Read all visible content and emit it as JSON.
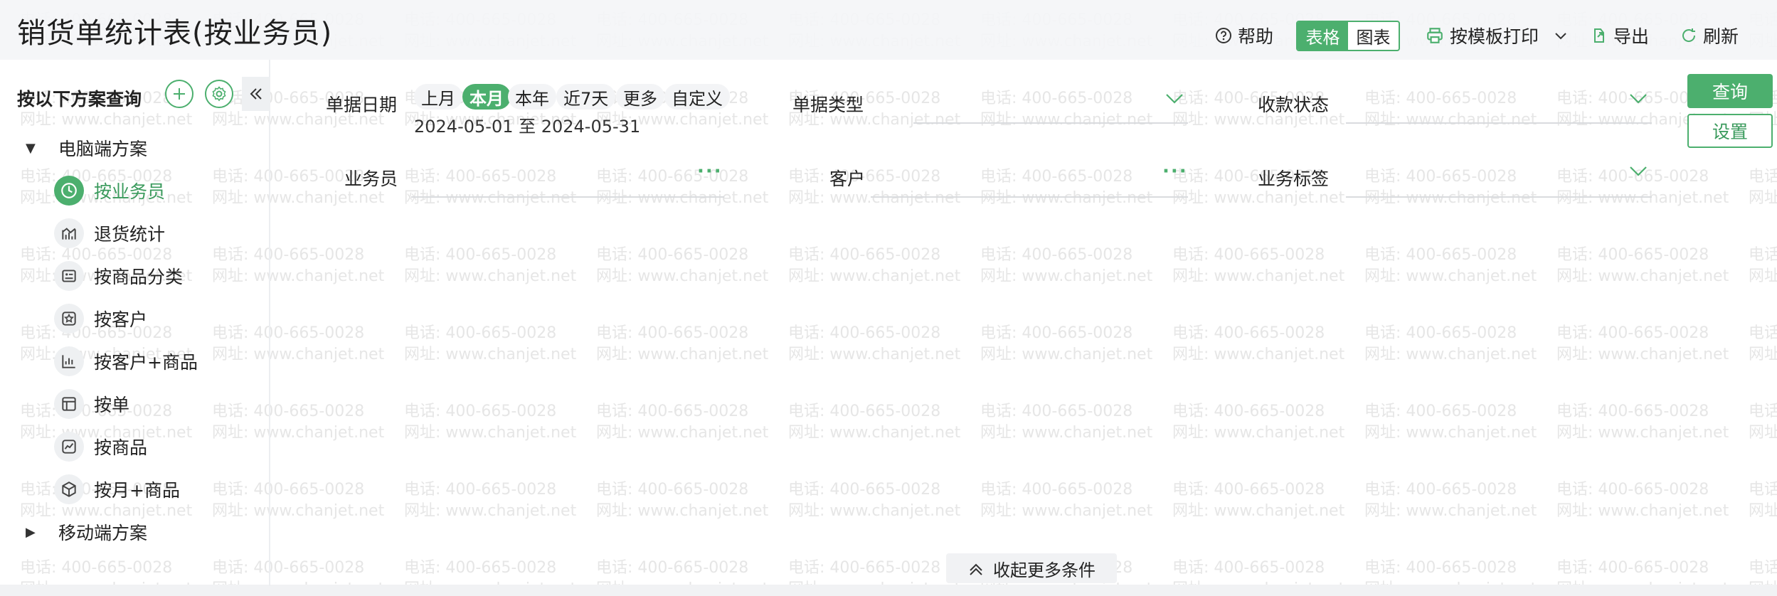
{
  "watermark": {
    "phone": "电话: 400-665-0028",
    "site": "网址: www.chanjet.net"
  },
  "header": {
    "title": "销货单统计表(按业务员)",
    "help_label": "帮助",
    "view_toggle": {
      "table_label": "表格",
      "chart_label": "图表",
      "selected": "表格"
    },
    "print_label": "按模板打印",
    "export_label": "导出",
    "refresh_label": "刷新"
  },
  "sidebar": {
    "title": "按以下方案查询",
    "groups": [
      {
        "label": "电脑端方案",
        "expanded": true,
        "items": [
          {
            "label": "按业务员",
            "icon": "clock-icon",
            "active": true
          },
          {
            "label": "退货统计",
            "icon": "line-chart-icon",
            "active": false
          },
          {
            "label": "按商品分类",
            "icon": "category-card-icon",
            "active": false
          },
          {
            "label": "按客户",
            "icon": "star-icon",
            "active": false
          },
          {
            "label": "按客户+商品",
            "icon": "bar-chart-icon",
            "active": false
          },
          {
            "label": "按单",
            "icon": "layout-icon",
            "active": false
          },
          {
            "label": "按商品",
            "icon": "trend-chart-icon",
            "active": false
          },
          {
            "label": "按月+商品",
            "icon": "cube-icon",
            "active": false
          }
        ]
      },
      {
        "label": "移动端方案",
        "expanded": false,
        "items": []
      }
    ]
  },
  "filters": {
    "date": {
      "label": "单据日期",
      "presets": [
        "上月",
        "本月",
        "本年",
        "近7天",
        "更多",
        "自定义"
      ],
      "selected": "本月",
      "range": "2024-05-01 至 2024-05-31"
    },
    "doc_type": {
      "label": "单据类型",
      "value": ""
    },
    "payment_status": {
      "label": "收款状态",
      "value": ""
    },
    "salesperson": {
      "label": "业务员",
      "value": ""
    },
    "customer": {
      "label": "客户",
      "value": ""
    },
    "business_tag": {
      "label": "业务标签",
      "value": ""
    }
  },
  "actions": {
    "query_label": "查询",
    "settings_label": "设置",
    "collapse_more_label": "收起更多条件"
  },
  "colors": {
    "accent": "#4caf6e",
    "header_bg": "#f4f5f7"
  }
}
